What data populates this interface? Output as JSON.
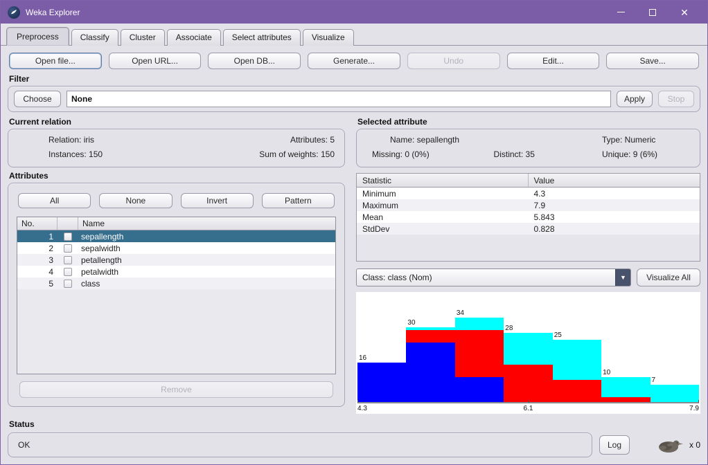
{
  "window": {
    "title": "Weka Explorer"
  },
  "tabs": [
    {
      "label": "Preprocess",
      "selected": true
    },
    {
      "label": "Classify",
      "selected": false
    },
    {
      "label": "Cluster",
      "selected": false
    },
    {
      "label": "Associate",
      "selected": false
    },
    {
      "label": "Select attributes",
      "selected": false
    },
    {
      "label": "Visualize",
      "selected": false
    }
  ],
  "toolbar": {
    "buttons": [
      {
        "label": "Open file...",
        "enabled": true,
        "focused": true
      },
      {
        "label": "Open URL...",
        "enabled": true
      },
      {
        "label": "Open DB...",
        "enabled": true
      },
      {
        "label": "Generate...",
        "enabled": true
      },
      {
        "label": "Undo",
        "enabled": false
      },
      {
        "label": "Edit...",
        "enabled": true
      },
      {
        "label": "Save...",
        "enabled": true
      }
    ]
  },
  "filter": {
    "heading": "Filter",
    "choose_label": "Choose",
    "value": "None",
    "apply_label": "Apply",
    "stop_label": "Stop",
    "stop_enabled": false
  },
  "current_relation": {
    "heading": "Current relation",
    "relation": "Relation: iris",
    "instances": "Instances: 150",
    "attributes": "Attributes: 5",
    "sum_of_weights": "Sum of weights: 150"
  },
  "attributes_panel": {
    "heading": "Attributes",
    "buttons": [
      "All",
      "None",
      "Invert",
      "Pattern"
    ],
    "table": {
      "headers": [
        "No.",
        "",
        "Name"
      ],
      "rows": [
        {
          "no": "1",
          "name": "sepallength",
          "checked": false,
          "selected": true
        },
        {
          "no": "2",
          "name": "sepalwidth",
          "checked": false,
          "selected": false
        },
        {
          "no": "3",
          "name": "petallength",
          "checked": false,
          "selected": false
        },
        {
          "no": "4",
          "name": "petalwidth",
          "checked": false,
          "selected": false
        },
        {
          "no": "5",
          "name": "class",
          "checked": false,
          "selected": false
        }
      ]
    },
    "remove_label": "Remove",
    "remove_enabled": false
  },
  "selected_attribute": {
    "heading": "Selected attribute",
    "name": "Name: sepallength",
    "missing": "Missing: 0 (0%)",
    "distinct": "Distinct: 35",
    "type": "Type: Numeric",
    "unique": "Unique: 9 (6%)"
  },
  "statistics": {
    "headers": [
      "Statistic",
      "Value"
    ],
    "rows": [
      {
        "stat": "Minimum",
        "value": "4.3"
      },
      {
        "stat": "Maximum",
        "value": "7.9"
      },
      {
        "stat": "Mean",
        "value": "5.843"
      },
      {
        "stat": "StdDev",
        "value": "0.828"
      }
    ]
  },
  "class_selector": {
    "value": "Class: class (Nom)",
    "visualize_all_label": "Visualize All"
  },
  "chart_data": {
    "type": "bar",
    "subtype": "stacked-histogram",
    "title": "Histogram of sepallength colored by class",
    "xlim": [
      4.3,
      7.9
    ],
    "ylim": [
      0,
      34
    ],
    "x_tick_labels": [
      "4.3",
      "6.1",
      "7.9"
    ],
    "categories": [
      "4.3-4.81",
      "4.81-5.33",
      "5.33-5.84",
      "5.84-6.36",
      "6.36-6.87",
      "6.87-7.39",
      "7.39-7.9"
    ],
    "bar_totals": [
      16,
      30,
      34,
      28,
      25,
      10,
      7
    ],
    "series": [
      {
        "name": "blue",
        "color": "#0000ff",
        "values": [
          16,
          24,
          10,
          0,
          0,
          0,
          0
        ]
      },
      {
        "name": "red",
        "color": "#ff0000",
        "values": [
          0,
          5,
          19,
          15,
          9,
          2,
          0
        ]
      },
      {
        "name": "cyan",
        "color": "#00ffff",
        "values": [
          0,
          1,
          5,
          13,
          16,
          8,
          7
        ]
      }
    ],
    "grid": false,
    "legend": "none"
  },
  "status": {
    "heading": "Status",
    "message": "OK",
    "log_label": "Log",
    "bird_counter": "x 0"
  },
  "colors": {
    "titlebar": "#7b5ca7",
    "selected_row": "#366e8e",
    "background": "#e3e2e8",
    "histogram_blue": "#0000ff",
    "histogram_red": "#ff0000",
    "histogram_cyan": "#00ffff"
  }
}
